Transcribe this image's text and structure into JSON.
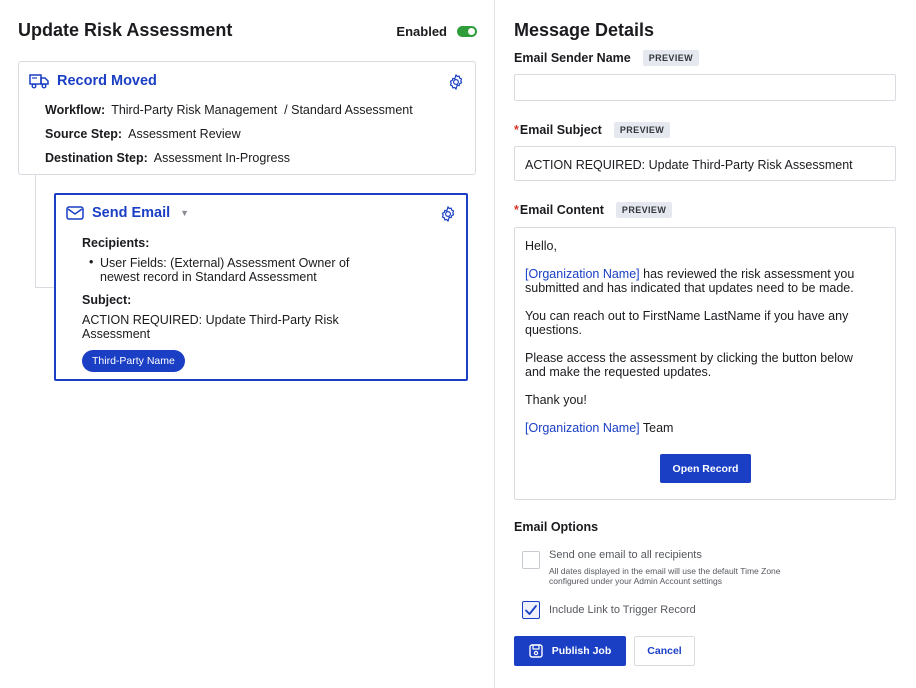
{
  "header": {
    "title": "Update Risk Assessment",
    "enabled_label": "Enabled",
    "enabled": true
  },
  "trigger_card": {
    "title": "Record Moved",
    "icon": "truck-icon",
    "fields": [
      {
        "label": "Workflow:",
        "value": "Third-Party Risk Management  / Standard Assessment"
      },
      {
        "label": "Source Step:",
        "value": "Assessment Review"
      },
      {
        "label": "Destination Step:",
        "value": "Assessment In-Progress"
      }
    ]
  },
  "action_card": {
    "title": "Send Email",
    "icon": "envelope-icon",
    "recipients_label": "Recipients:",
    "recipient_line1": "User Fields: (External) Assessment Owner of",
    "recipient_line2": "newest record in Standard Assessment",
    "subject_label": "Subject:",
    "subject_line1": "ACTION REQUIRED: Update Third-Party Risk",
    "subject_line2": "Assessment",
    "pill": "Third-Party Name"
  },
  "message_details": {
    "title": "Message Details",
    "preview_badge": "PREVIEW",
    "sender_label": "Email Sender Name",
    "sender_value": "",
    "subject_label": "Email Subject",
    "subject_value": "ACTION REQUIRED: Update Third-Party Risk Assessment",
    "content_label": "Email Content",
    "content": {
      "greeting": "Hello,",
      "org_token": "[Organization Name]",
      "p1_rest": " has reviewed the risk assessment you",
      "p1_line2": "submitted and has indicated that updates need to be made.",
      "p2_line1": "You can reach out to FirstName LastName if you have any",
      "p2_line2": "questions.",
      "p3_line1": "Please access the assessment by clicking the button below",
      "p3_line2": "and make the requested updates.",
      "thanks": "Thank you!",
      "team_rest": " Team",
      "button": "Open Record"
    }
  },
  "email_options": {
    "title": "Email Options",
    "send_one_label": "Send one email to all recipients",
    "send_one_sub1": "All dates displayed in the email will use the default Time Zone",
    "send_one_sub2": "configured under your Admin Account settings",
    "send_one_checked": false,
    "include_link_label": "Include Link to Trigger Record",
    "include_link_checked": true
  },
  "footer": {
    "publish": "Publish Job",
    "cancel": "Cancel"
  },
  "colors": {
    "accent": "#1a3fc4",
    "toggle_on": "#2e9d3a",
    "required": "#d2362b"
  }
}
